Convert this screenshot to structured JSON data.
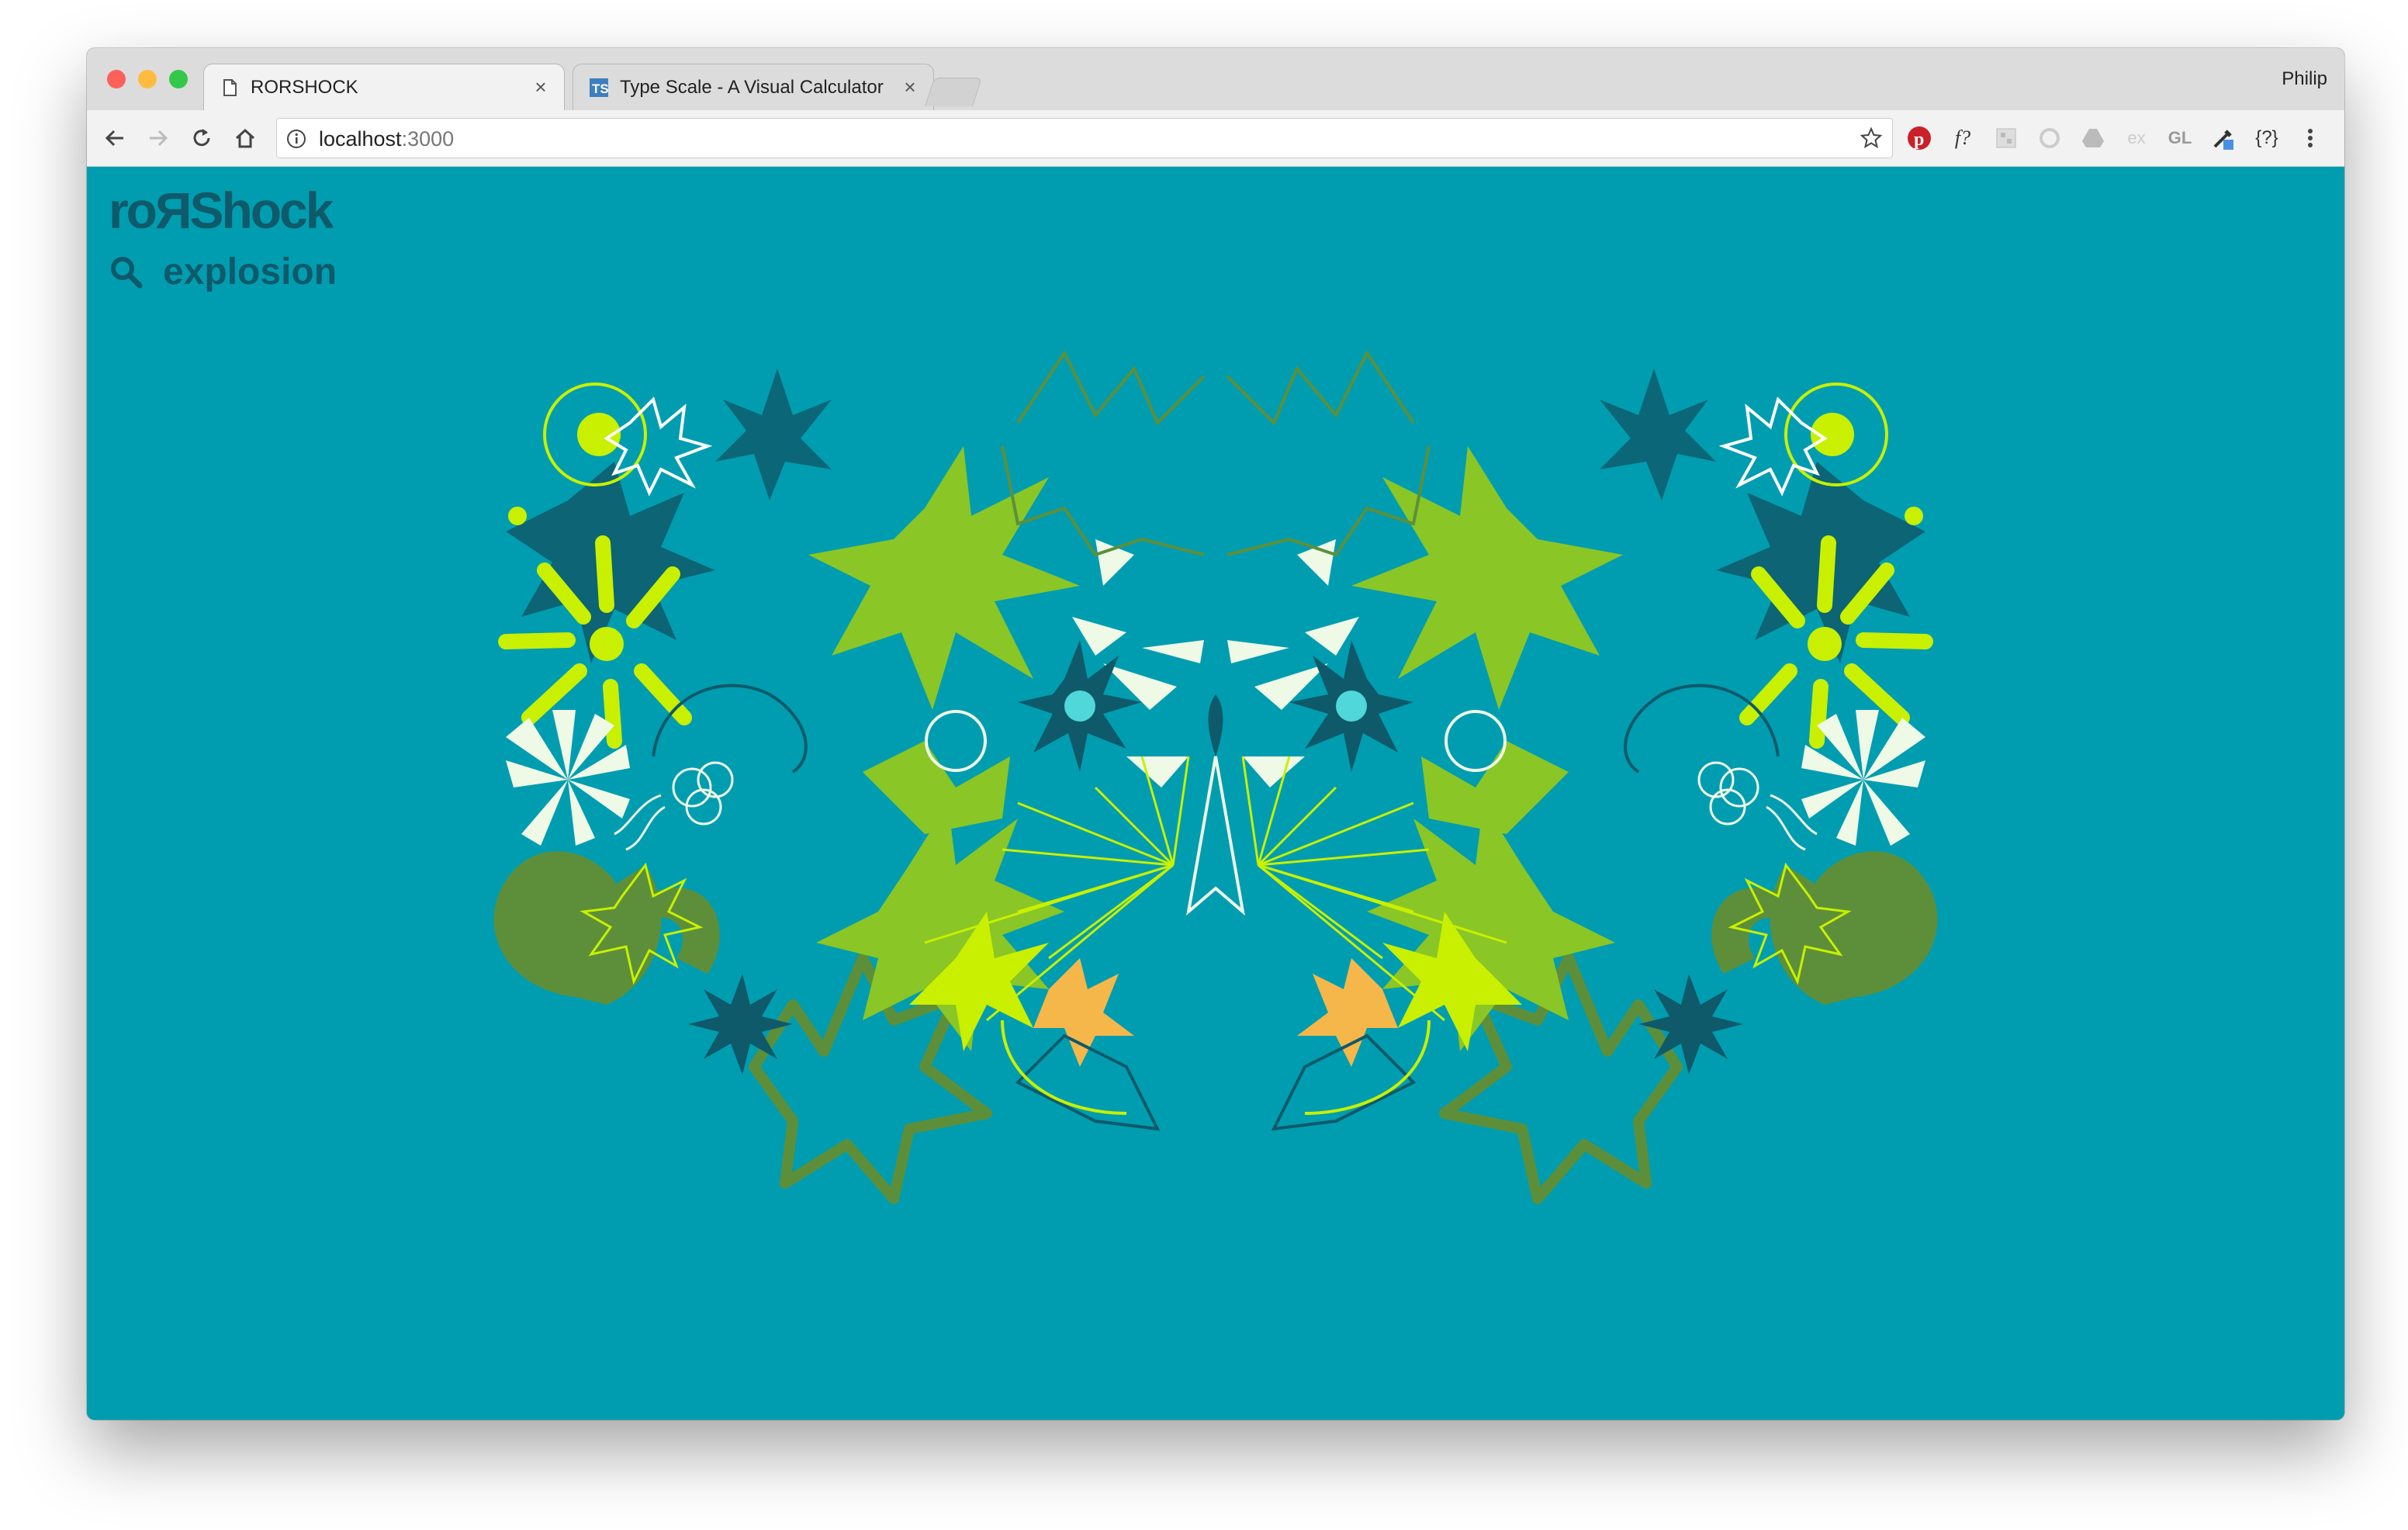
{
  "browser": {
    "tabs": [
      {
        "title": "RORSHOCK",
        "favicon": "page-icon",
        "active": true
      },
      {
        "title": "Type Scale - A Visual Calculator",
        "favicon": "typescale-favicon",
        "active": false
      }
    ],
    "profile_name": "Philip",
    "address": {
      "host": "localhost",
      "port": ":3000"
    },
    "extensions": [
      "pinterest-icon",
      "font-identifier-icon",
      "extension-icon",
      "extension-icon",
      "drive-icon",
      "ex-icon",
      "gl-icon",
      "eyedropper-icon",
      "json-icon",
      "menu-icon"
    ],
    "extension_labels": {
      "font": "f?",
      "ex": "ex",
      "gl": "GL",
      "json": "{?}"
    }
  },
  "app": {
    "logo": "roЯShock",
    "search_query": "explosion"
  },
  "colors": {
    "background": "#009db0",
    "dark_teal": "#0e5a6a",
    "lime": "#c8f000",
    "green": "#8ac626",
    "olive": "#5d8f3a",
    "cream": "#eef9e6",
    "orange": "#f5b74a"
  }
}
